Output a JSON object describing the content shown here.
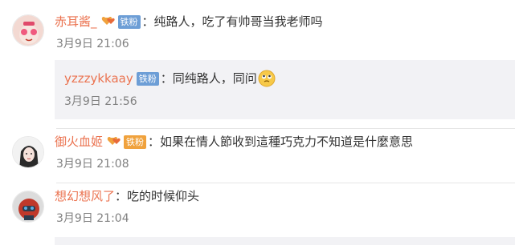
{
  "comments": [
    {
      "username": "赤耳酱_",
      "badge": "铁粉",
      "separator": "：",
      "text": "纯路人，吃了有帅哥当我老师吗",
      "time": "3月9日 21:06"
    },
    {
      "username": "御火血姬",
      "badge": "铁粉",
      "separator": "：",
      "text": "如果在情人節收到這種巧克力不知道是什麼意思",
      "time": "3月9日 21:08"
    },
    {
      "username": "想幻想风了",
      "separator": "：",
      "text": "吃的时候仰头",
      "time": "3月9日 21:04"
    }
  ],
  "reply": {
    "username": "yzzzykkaay",
    "badge": "铁粉",
    "separator": "：",
    "text": "同纯路人，同问",
    "time": "3月9日 21:56"
  },
  "colors": {
    "username": "#eb7350",
    "badge_blue": "#6d9ed6",
    "badge_gold": "#f0a23d",
    "reply_bg": "#f2f2f5",
    "time": "#808080"
  }
}
